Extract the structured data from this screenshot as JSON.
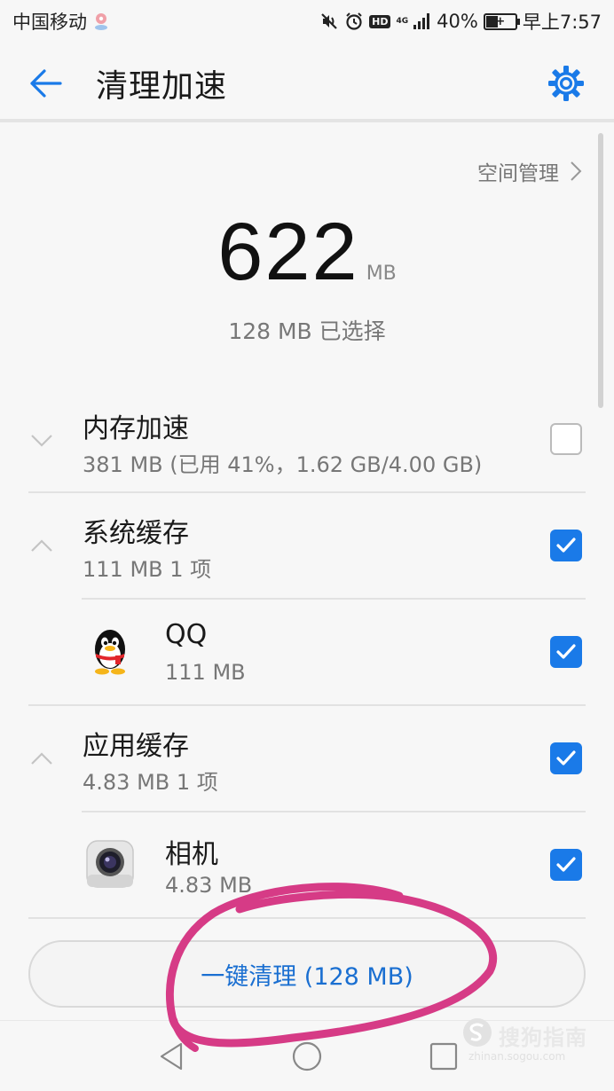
{
  "status_bar": {
    "carrier": "中国移动",
    "hd": "HD",
    "network": "4G",
    "battery_percent": "40%",
    "battery_level": 0.4,
    "time": "早上7:57",
    "icons": [
      "location-icon",
      "mute-icon",
      "alarm-icon",
      "signal-icon",
      "battery-icon"
    ]
  },
  "header": {
    "title": "清理加速"
  },
  "storage_link": {
    "label": "空间管理"
  },
  "summary": {
    "total_value": "622",
    "total_unit": "MB",
    "selected_text": "128 MB 已选择"
  },
  "items": [
    {
      "title": "内存加速",
      "subtitle": "381 MB (已用 41%，1.62 GB/4.00 GB)",
      "expanded": false,
      "checked": false
    },
    {
      "title": "系统缓存",
      "subtitle": "111 MB  1 项",
      "expanded": true,
      "checked": true,
      "apps": [
        {
          "name": "QQ",
          "size": "111 MB",
          "icon": "qq-icon",
          "checked": true
        }
      ]
    },
    {
      "title": "应用缓存",
      "subtitle": "4.83 MB  1 项",
      "expanded": true,
      "checked": true,
      "apps": [
        {
          "name": "相机",
          "size": "4.83 MB",
          "icon": "camera-icon",
          "checked": true
        }
      ]
    }
  ],
  "clean_button": {
    "label": "一键清理 (128 MB)"
  },
  "watermark": {
    "main": "搜狗指南",
    "sub": "zhinan.sogou.com"
  },
  "colors": {
    "accent": "#1a7ae8",
    "annotation": "#d63b86"
  }
}
